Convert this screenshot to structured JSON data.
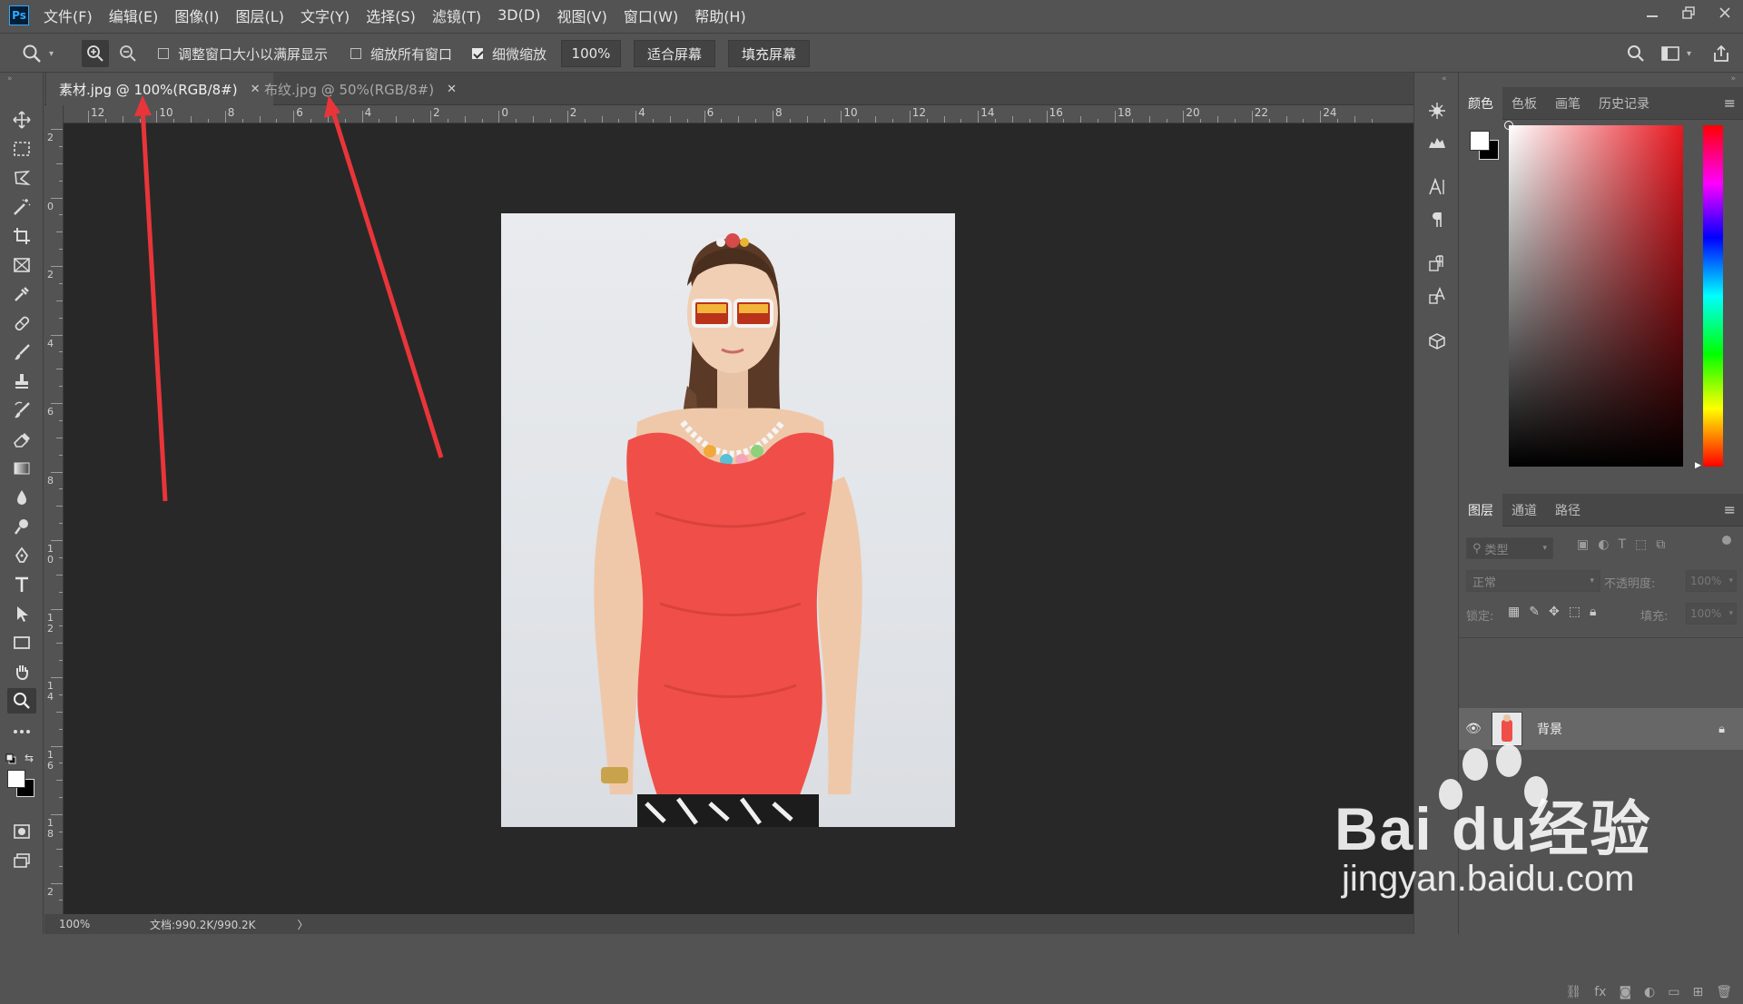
{
  "app": {
    "logo": "Ps",
    "accent": "#31a8ff"
  },
  "menu": [
    "文件(F)",
    "编辑(E)",
    "图像(I)",
    "图层(L)",
    "文字(Y)",
    "选择(S)",
    "滤镜(T)",
    "3D(D)",
    "视图(V)",
    "窗口(W)",
    "帮助(H)"
  ],
  "window_controls": [
    "minimize-icon",
    "restore-icon",
    "close-icon"
  ],
  "options": {
    "resize_windows_label": "调整窗口大小以满屏显示",
    "resize_windows_checked": false,
    "zoom_all_label": "缩放所有窗口",
    "zoom_all_checked": false,
    "scrubby_zoom_label": "细微缩放",
    "scrubby_zoom_checked": true,
    "zoom_value": "100%",
    "fit_screen_label": "适合屏幕",
    "fill_screen_label": "填充屏幕"
  },
  "tabs": [
    {
      "label": "素材.jpg @ 100%(RGB/8#)",
      "active": true
    },
    {
      "label": "布纹.jpg @ 50%(RGB/8#)",
      "active": false
    }
  ],
  "ruler": {
    "h_labels": [
      "12",
      "10",
      "8",
      "6",
      "4",
      "2",
      "0",
      "2",
      "4",
      "6",
      "8",
      "10",
      "12",
      "14",
      "16",
      "18",
      "20",
      "22",
      "24"
    ],
    "v_labels": [
      "2",
      "0",
      "2",
      "4",
      "6",
      "8",
      "10",
      "12",
      "14",
      "16",
      "18",
      "2"
    ]
  },
  "status": {
    "zoom": "100%",
    "doc_info": "文档:990.2K/990.2K",
    "arrow": "〉"
  },
  "color_panel": {
    "tabs": [
      "颜色",
      "色板",
      "画笔",
      "历史记录"
    ],
    "active_tab": "颜色",
    "fg": "#ffffff",
    "bg": "#000000",
    "hue": "#e8171f"
  },
  "layers_panel": {
    "tabs": [
      "图层",
      "通道",
      "路径"
    ],
    "active_tab": "图层",
    "filter_label": "类型",
    "blend_mode": "正常",
    "opacity_label": "不透明度:",
    "opacity_value": "100%",
    "lock_label": "锁定:",
    "fill_label": "填充:",
    "fill_value": "100%",
    "layers": [
      {
        "name": "背景",
        "visible": true,
        "locked": true
      }
    ]
  },
  "watermark": {
    "brand": "Bai du经验",
    "url": "jingyan.baidu.com"
  },
  "annotation_color": "#e8353a"
}
